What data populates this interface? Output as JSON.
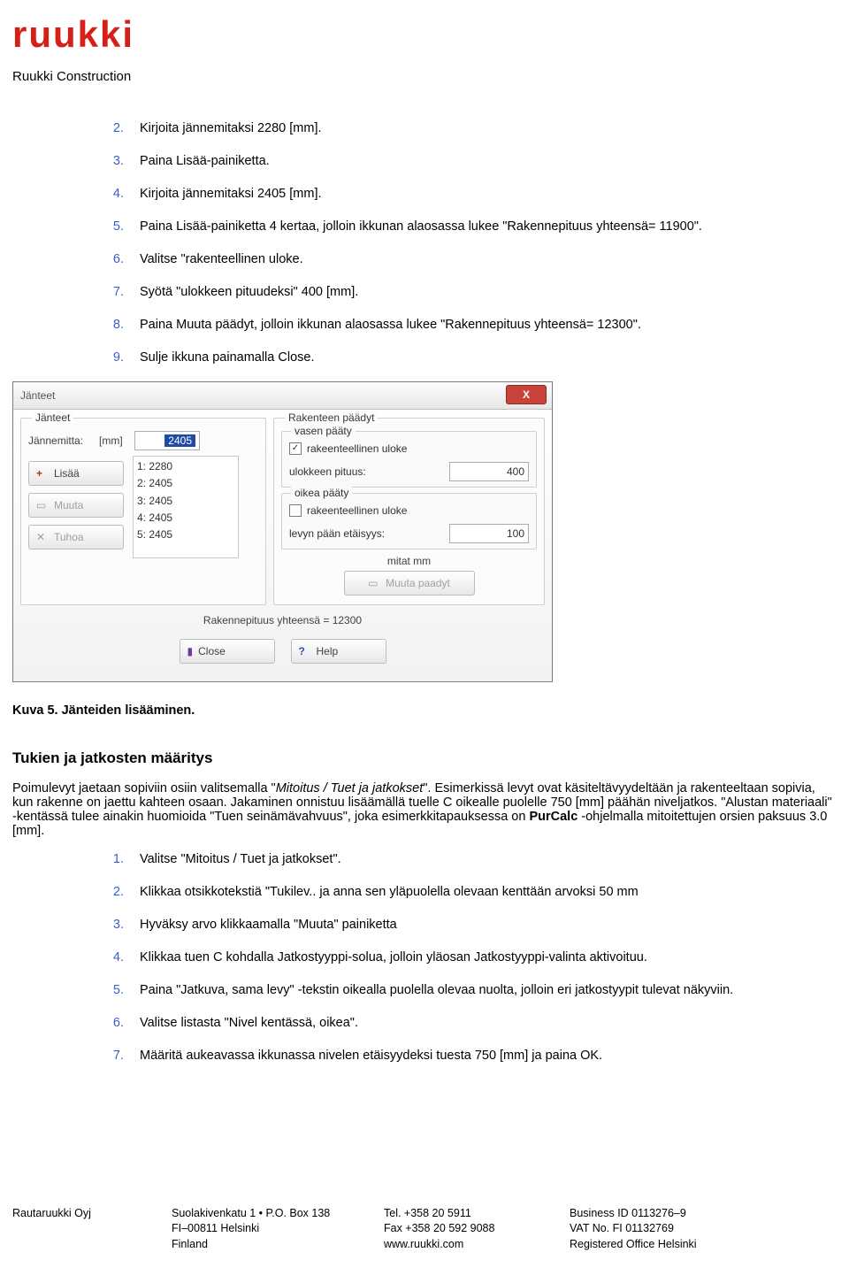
{
  "logo": "ruukki",
  "company": "Ruukki Construction",
  "steps_top": [
    {
      "n": "2.",
      "t": "Kirjoita jännemitaksi 2280 [mm]."
    },
    {
      "n": "3.",
      "t": "Paina Lisää-painiketta."
    },
    {
      "n": "4.",
      "t": "Kirjoita jännemitaksi 2405 [mm]."
    },
    {
      "n": "5.",
      "t": "Paina Lisää-painiketta 4 kertaa, jolloin ikkunan alaosassa lukee \"Rakennepituus yhteensä= 11900\"."
    },
    {
      "n": "6.",
      "t": "Valitse \"rakenteellinen uloke."
    },
    {
      "n": "7.",
      "t": "Syötä \"ulokkeen pituudeksi\" 400 [mm]."
    },
    {
      "n": "8.",
      "t": "Paina Muuta päädyt, jolloin ikkunan alaosassa lukee \"Rakennepituus yhteensä= 12300\"."
    },
    {
      "n": "9.",
      "t": "Sulje ikkuna painamalla Close."
    }
  ],
  "dialog": {
    "title": "Jänteet",
    "left_group": "Jänteet",
    "span_label": "Jännemitta:",
    "span_unit": "[mm]",
    "span_value": "2405",
    "list": [
      "1: 2280",
      "2: 2405",
      "3: 2405",
      "4: 2405",
      "5: 2405"
    ],
    "btn_add": "Lisää",
    "btn_muuta": "Muuta",
    "btn_tuhoa": "Tuhoa",
    "right_group": "Rakenteen päädyt",
    "vasen": "vasen pääty",
    "oikea": "oikea pääty",
    "chk_uloke": "rakeenteellinen uloke",
    "len_label": "ulokkeen pituus:",
    "len_value": "400",
    "dist_label": "levyn pään etäisyys:",
    "dist_value": "100",
    "unit_note": "mitat mm",
    "btn_muuta_paadyt": "Muuta paadyt",
    "total_label": "Rakennepituus yhteensä =  12300",
    "btn_close": "Close",
    "btn_help": "Help"
  },
  "caption": "Kuva 5. Jänteiden lisääminen.",
  "section_heading": "Tukien ja jatkosten määritys",
  "para_main_1": "Poimulevyt jaetaan sopiviin osiin valitsemalla \"",
  "para_main_italic": "Mitoitus / Tuet ja jatkokset",
  "para_main_2": "\". Esimerkissä levyt ovat käsiteltävyydeltään ja rakenteeltaan sopivia, kun rakenne on jaettu kahteen osaan. Jakaminen onnistuu lisäämällä tuelle C oikealle puolelle 750 [mm] päähän niveljatkos. \"Alustan materiaali\" -kentässä tulee ainakin huomioida \"Tuen seinämävahvuus\", joka esimerkkitapauksessa on ",
  "para_bold": "PurCalc",
  "para_main_3": " -ohjelmalla mitoitettujen orsien paksuus 3.0 [mm].",
  "steps_bottom": [
    {
      "n": "1.",
      "t": "Valitse \"Mitoitus / Tuet ja jatkokset\"."
    },
    {
      "n": "2.",
      "t": "Klikkaa otsikkotekstiä \"Tukilev.. ja anna sen yläpuolella olevaan kenttään arvoksi 50 mm"
    },
    {
      "n": "3.",
      "t": "Hyväksy arvo klikkaamalla \"Muuta\" painiketta"
    },
    {
      "n": "4.",
      "t": "Klikkaa tuen C kohdalla Jatkostyyppi-solua, jolloin yläosan Jatkostyyppi-valinta aktivoituu."
    },
    {
      "n": "5.",
      "t": "Paina \"Jatkuva, sama levy\" -tekstin oikealla puolella olevaa nuolta, jolloin eri jatkostyypit tulevat näkyviin."
    },
    {
      "n": "6.",
      "t": "Valitse listasta \"Nivel kentässä, oikea\"."
    },
    {
      "n": "7.",
      "t": "Määritä aukeavassa ikkunassa nivelen etäisyydeksi tuesta 750 [mm] ja paina OK."
    }
  ],
  "footer": {
    "c1": [
      "Rautaruukki Oyj"
    ],
    "c2": [
      "Suolakivenkatu 1 • P.O. Box 138",
      "FI–00811 Helsinki",
      "Finland"
    ],
    "c3": [
      "Tel. +358 20 5911",
      "Fax +358 20 592 9088",
      "www.ruukki.com"
    ],
    "c4": [
      "Business ID 0113276–9",
      "VAT No. FI 01132769",
      "Registered Office Helsinki"
    ]
  }
}
